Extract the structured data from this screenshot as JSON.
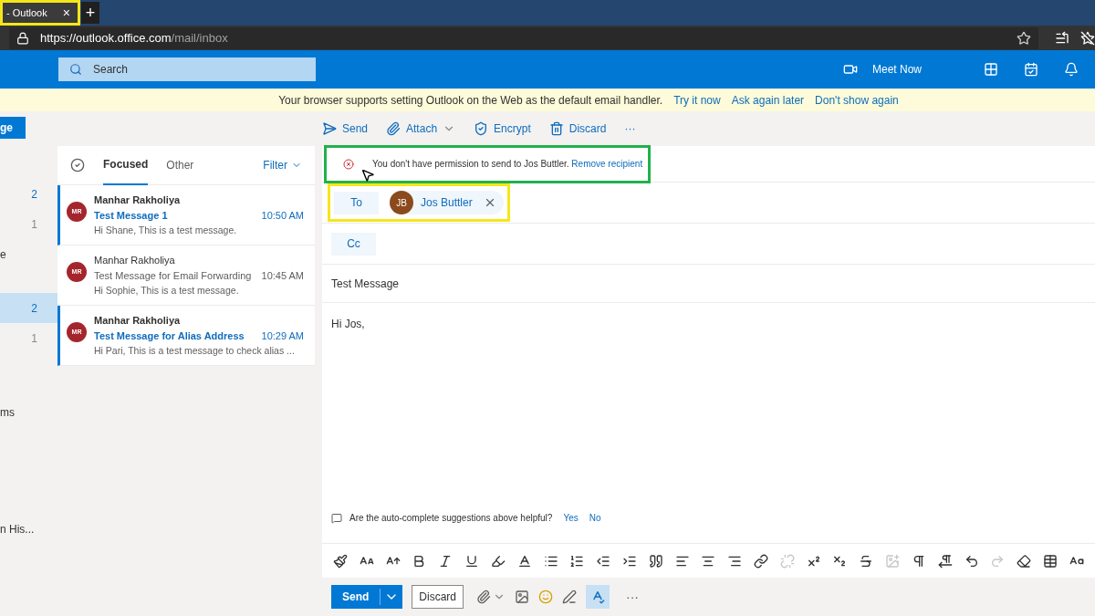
{
  "browser": {
    "tab_title": "- Outlook",
    "tab_close": "×",
    "new_tab": "+",
    "url_host": "https://outlook.office.com",
    "url_path": "/mail/inbox",
    "tab_highlighted": true
  },
  "header": {
    "search_placeholder": "Search",
    "meet_now": "Meet Now"
  },
  "banner": {
    "message": "Your browser supports setting Outlook on the Web as the default email handler.",
    "links": [
      "Try it now",
      "Ask again later",
      "Don't show again"
    ]
  },
  "nav": {
    "new_button": "ge",
    "items": [
      {
        "count": "2",
        "unread": true,
        "selected": false
      },
      {
        "count": "1",
        "unread": false,
        "selected": false
      },
      {
        "label": "e",
        "selected": false
      },
      {
        "count": "2",
        "unread": true,
        "selected": true
      },
      {
        "count": "1",
        "unread": false,
        "selected": false
      },
      {
        "label": "ms",
        "selected": false
      },
      {
        "label": "n His...",
        "selected": false
      }
    ]
  },
  "commands": [
    {
      "kind": "send",
      "label": "Send"
    },
    {
      "kind": "attach",
      "label": "Attach"
    },
    {
      "kind": "encrypt",
      "label": "Encrypt"
    },
    {
      "kind": "discard",
      "label": "Discard"
    },
    {
      "kind": "more",
      "label": "···"
    }
  ],
  "list": {
    "tabs": [
      {
        "label": "Focused",
        "selected": true
      },
      {
        "label": "Other",
        "selected": false
      }
    ],
    "filter": "Filter",
    "messages": [
      {
        "initials": "MR",
        "sender": "Manhar Rakholiya",
        "subject": "Test Message 1",
        "time": "10:50 AM",
        "preview": "Hi Shane, This is a test message.",
        "unread": true
      },
      {
        "initials": "MR",
        "sender": "Manhar Rakholiya",
        "subject": "Test Message for Email Forwarding",
        "time": "10:45 AM",
        "preview": "Hi Sophie, This is a test message.",
        "unread": false
      },
      {
        "initials": "MR",
        "sender": "Manhar Rakholiya",
        "subject": "Test Message for Alias Address",
        "time": "10:29 AM",
        "preview": "Hi Pari, This is a test message to check alias ...",
        "unread": true
      }
    ]
  },
  "compose": {
    "error": {
      "message": "You don't have permission to send to Jos Buttler.",
      "link": "Remove recipient",
      "highlighted": true
    },
    "to_label": "To",
    "to_highlighted": true,
    "recipients": [
      {
        "initials": "JB",
        "name": "Jos Buttler",
        "color": "#8b4a1c"
      }
    ],
    "cc_label": "Cc",
    "subject": "Test Message",
    "body": "Hi Jos,",
    "feedback": {
      "question": "Are the auto-complete suggestions above helpful?",
      "yes": "Yes",
      "no": "No"
    },
    "send": "Send",
    "discard": "Discard"
  }
}
